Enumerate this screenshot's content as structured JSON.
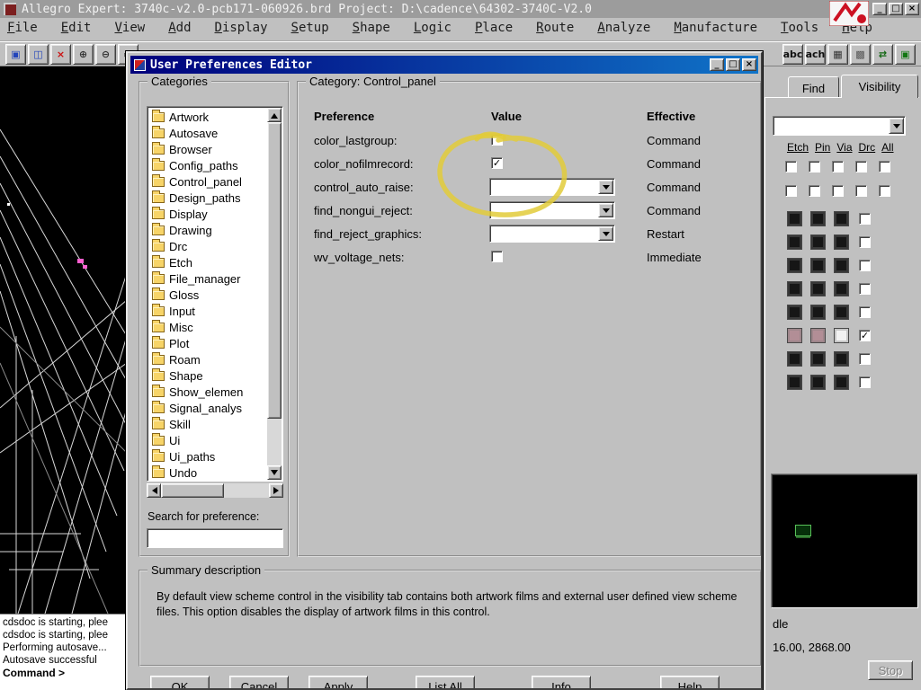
{
  "icons": {
    "check": "✓",
    "minimize": "_",
    "maximize": "□",
    "close": "×"
  },
  "window": {
    "title": "Allegro Expert: 3740c-v2.0-pcb171-060926.brd  Project: D:\\cadence\\64302-3740C-V2.0",
    "menus": [
      {
        "label": "File"
      },
      {
        "label": "Edit"
      },
      {
        "label": "View"
      },
      {
        "label": "Add"
      },
      {
        "label": "Display"
      },
      {
        "label": "Setup"
      },
      {
        "label": "Shape"
      },
      {
        "label": "Logic"
      },
      {
        "label": "Place"
      },
      {
        "label": "Route"
      },
      {
        "label": "Analyze"
      },
      {
        "label": "Manufacture"
      },
      {
        "label": "Tools"
      },
      {
        "label": "Help"
      }
    ]
  },
  "toolbar": {
    "left": [
      {
        "name": "windows-cascade-icon",
        "glyph": "▣",
        "color": "#2244bb"
      },
      {
        "name": "windows-tile-icon",
        "glyph": "◫",
        "color": "#2244bb"
      },
      {
        "name": "delete-icon",
        "glyph": "×",
        "color": "#cc1111"
      },
      {
        "name": "zoom-in-icon",
        "glyph": "⊕",
        "color": "#333333"
      },
      {
        "name": "zoom-out-icon",
        "glyph": "⊖",
        "color": "#333333"
      },
      {
        "name": "zoom-fit-icon",
        "glyph": "▭",
        "color": "#333333"
      }
    ],
    "right": [
      {
        "name": "text-abc-icon",
        "glyph": "abc",
        "color": "#111111"
      },
      {
        "name": "text-attach-icon",
        "glyph": "ach",
        "color": "#111111"
      },
      {
        "name": "grid-icon",
        "glyph": "▦",
        "color": "#333333"
      },
      {
        "name": "shadow-mode-icon",
        "glyph": "▩",
        "color": "#555555"
      },
      {
        "name": "swap-icon",
        "glyph": "⇄",
        "color": "#116611"
      },
      {
        "name": "color-icon",
        "glyph": "▣",
        "color": "#117711"
      }
    ]
  },
  "dialog": {
    "title": "User Preferences Editor",
    "categories": {
      "label": "Categories",
      "items": [
        "Artwork",
        "Autosave",
        "Browser",
        "Config_paths",
        "Control_panel",
        "Design_paths",
        "Display",
        "Drawing",
        "Drc",
        "Etch",
        "File_manager",
        "Gloss",
        "Input",
        "Misc",
        "Plot",
        "Roam",
        "Shape",
        "Show_elemen",
        "Signal_analys",
        "Skill",
        "Ui",
        "Ui_paths",
        "Undo"
      ],
      "search_label": "Search for preference:",
      "search_value": ""
    },
    "category_panel": {
      "label": "Category:  Control_panel",
      "columns": [
        "Preference",
        "Value",
        "Effective"
      ],
      "rows": [
        {
          "preference": "color_lastgroup:",
          "control": "checkbox",
          "checked": false,
          "effective": "Command"
        },
        {
          "preference": "color_nofilmrecord:",
          "control": "checkbox",
          "checked": true,
          "effective": "Command"
        },
        {
          "preference": "control_auto_raise:",
          "control": "dropdown",
          "value": "",
          "effective": "Command"
        },
        {
          "preference": "find_nongui_reject:",
          "control": "dropdown",
          "value": "",
          "effective": "Command"
        },
        {
          "preference": "find_reject_graphics:",
          "control": "dropdown",
          "value": "",
          "effective": "Restart"
        },
        {
          "preference": "wv_voltage_nets:",
          "control": "checkbox",
          "checked": false,
          "effective": "Immediate"
        }
      ]
    },
    "summary": {
      "label": "Summary description",
      "text": "By default view scheme control in the visibility tab contains both artwork films and external user defined view scheme files. This option disables the display of artwork films in this control."
    },
    "buttons": [
      "OK",
      "Cancel",
      "Apply",
      "List All",
      "Info",
      "Help"
    ]
  },
  "right_panel": {
    "tabs": [
      {
        "label": "Find"
      },
      {
        "label": "Visibility"
      }
    ],
    "active_tab": "Visibility",
    "view_selector_value": "",
    "column_links": [
      "Etch",
      "Pin",
      "Via",
      "Drc",
      "All"
    ],
    "checkbox_rows": [
      [
        false,
        false,
        false,
        false,
        false
      ],
      [
        false,
        false,
        false,
        false,
        false
      ]
    ],
    "swatch_rows": [
      {
        "colors": [
          "#161616",
          "#161616",
          "#161616"
        ],
        "checked": false
      },
      {
        "colors": [
          "#161616",
          "#161616",
          "#161616"
        ],
        "checked": false
      },
      {
        "colors": [
          "#161616",
          "#161616",
          "#161616"
        ],
        "checked": false
      },
      {
        "colors": [
          "#161616",
          "#161616",
          "#161616"
        ],
        "checked": false
      },
      {
        "colors": [
          "#161616",
          "#161616",
          "#161616"
        ],
        "checked": false
      },
      {
        "colors": [
          "#b28e96",
          "#b28e96",
          "#f2f2f2"
        ],
        "checked": true
      },
      {
        "colors": [
          "#161616",
          "#161616",
          "#161616"
        ],
        "checked": false
      },
      {
        "colors": [
          "#161616",
          "#161616",
          "#161616"
        ],
        "checked": false
      }
    ],
    "status_mode": "dle",
    "coordinates": "16.00, 2868.00",
    "stop_label": "Stop"
  },
  "console": {
    "lines": [
      "cdsdoc is starting, plee",
      "cdsdoc is starting, plee",
      "Performing autosave...",
      "Autosave successful"
    ],
    "prompt": "Command >"
  },
  "annotation": {
    "color": "#e2cb3a"
  }
}
